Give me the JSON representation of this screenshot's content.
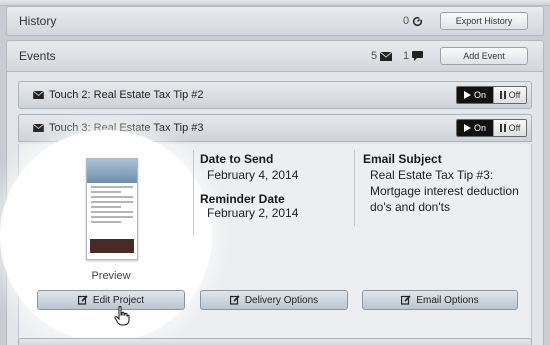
{
  "history": {
    "title": "History",
    "count": "0",
    "icon": "refresh-icon",
    "button": "Export History"
  },
  "events": {
    "title": "Events",
    "email_count": "5",
    "email_icon": "envelope-icon",
    "comment_count": "1",
    "comment_icon": "comment-icon",
    "button": "Add Event"
  },
  "touches": [
    {
      "title": "Touch 2: Real Estate Tax Tip #2",
      "toggle_on": "On",
      "toggle_off": "Off",
      "active": "on"
    },
    {
      "title": "Touch 3: Real Estate Tax Tip #3",
      "toggle_on": "On",
      "toggle_off": "Off",
      "active": "on"
    }
  ],
  "detail": {
    "preview_label": "Preview",
    "date_to_send_label": "Date to Send",
    "date_to_send": "February 4, 2014",
    "reminder_date_label": "Reminder Date",
    "reminder_date": "February 2, 2014",
    "email_subject_label": "Email Subject",
    "email_subject_line1": "Real Estate Tax Tip #3:",
    "email_subject_line2": "Mortgage interest deduction",
    "email_subject_line3": "do's and don'ts"
  },
  "actions": {
    "edit_project": "Edit Project",
    "delivery_options": "Delivery Options",
    "email_options": "Email Options",
    "icon": "edit-icon"
  },
  "colors": {
    "toggle_on_bg": "#111111",
    "action_btn_bg": "#c4cbd4",
    "panel_bg": "#e2e5e9"
  }
}
